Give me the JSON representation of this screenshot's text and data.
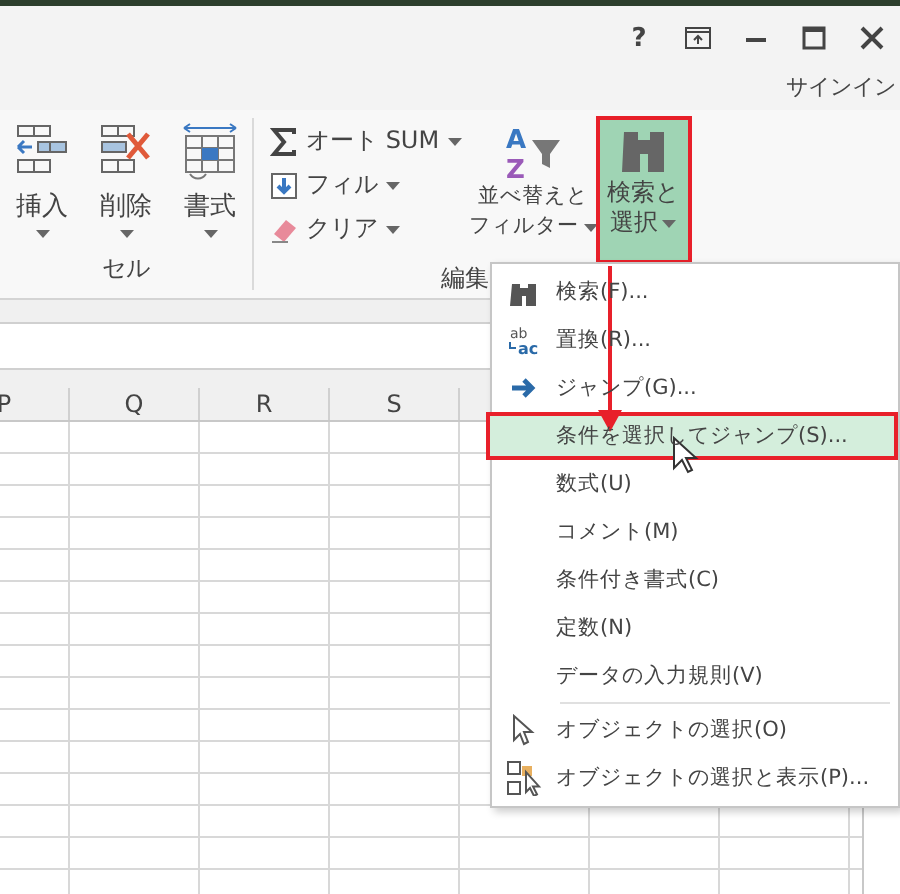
{
  "title_bar": {
    "help_label": "?",
    "sign_in": "サインイン"
  },
  "ribbon": {
    "cells_group": {
      "label": "セル",
      "buttons": [
        {
          "kind": "insert",
          "label": "挿入"
        },
        {
          "kind": "delete",
          "label": "削除"
        },
        {
          "kind": "format",
          "label": "書式"
        }
      ]
    },
    "editing_group": {
      "label": "編集",
      "small_buttons": [
        {
          "kind": "sum",
          "label": "オート SUM"
        },
        {
          "kind": "fill",
          "label": "フィル"
        },
        {
          "kind": "clear",
          "label": "クリア"
        }
      ],
      "sort_button": {
        "icon_letters": [
          "A",
          "Z"
        ],
        "lines": [
          "並べ替えと",
          "フィルター"
        ]
      },
      "find_button": {
        "lines": [
          "検索と",
          "選択"
        ],
        "selected": true,
        "highlighted": true
      }
    }
  },
  "sheet": {
    "columns": [
      "P",
      "Q",
      "R",
      "S"
    ]
  },
  "menu": {
    "items": [
      {
        "kind": "find",
        "label": "検索(F)...",
        "selected": false
      },
      {
        "kind": "replace",
        "icon_text": [
          "ab",
          "ac"
        ],
        "label": "置換(R)...",
        "selected": false
      },
      {
        "kind": "goto",
        "label": "ジャンプ(G)...",
        "selected": false
      },
      {
        "kind": "plain",
        "label": "条件を選択してジャンプ(S)...",
        "selected": true,
        "highlighted": true
      },
      {
        "kind": "plain",
        "label": "数式(U)",
        "selected": false
      },
      {
        "kind": "plain",
        "label": "コメント(M)",
        "selected": false
      },
      {
        "kind": "plain",
        "label": "条件付き書式(C)",
        "selected": false
      },
      {
        "kind": "plain",
        "label": "定数(N)",
        "selected": false
      },
      {
        "kind": "plain",
        "label": "データの入力規則(V)",
        "selected": false
      },
      {
        "kind": "select_objects",
        "label": "オブジェクトの選択(O)",
        "selected": false,
        "separator_before": true
      },
      {
        "kind": "selection_pane",
        "label": "オブジェクトの選択と表示(P)...",
        "selected": false
      }
    ]
  }
}
